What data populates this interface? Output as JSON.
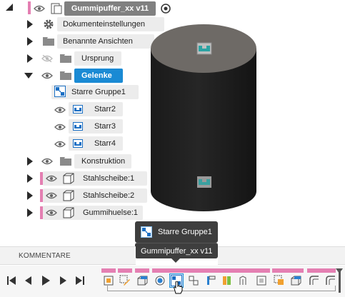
{
  "browser": {
    "root": {
      "label": "Gummipuffer_xx v11"
    },
    "items": [
      {
        "label": "Dokumenteinstellungen",
        "icon": "gear-icon"
      },
      {
        "label": "Benannte Ansichten",
        "icon": "folder-icon"
      },
      {
        "label": "Ursprung",
        "icon": "folder-icon"
      },
      {
        "label": "Gelenke",
        "icon": "folder-icon"
      },
      {
        "label": "Starre Gruppe1",
        "icon": "rigid-group-icon"
      },
      {
        "label": "Starr2",
        "icon": "rigid-joint-icon"
      },
      {
        "label": "Starr3",
        "icon": "rigid-joint-icon"
      },
      {
        "label": "Starr4",
        "icon": "rigid-joint-icon"
      },
      {
        "label": "Konstruktion",
        "icon": "folder-icon"
      },
      {
        "label": "Stahlscheibe:1",
        "icon": "component-icon"
      },
      {
        "label": "Stahlscheibe:2",
        "icon": "component-icon"
      },
      {
        "label": "Gummihuelse:1",
        "icon": "component-icon"
      }
    ]
  },
  "tooltip": {
    "title": "Starre Gruppe1",
    "subtitle": "Gummipuffer_xx v11"
  },
  "comments": {
    "label": "KOMMENTARE"
  },
  "colors": {
    "selected": "#1a8ad4",
    "accent_pink": "#e47fb2",
    "root_bg": "#808080",
    "model_dark": "#1e1e1e",
    "model_top": "#6e6a66"
  }
}
